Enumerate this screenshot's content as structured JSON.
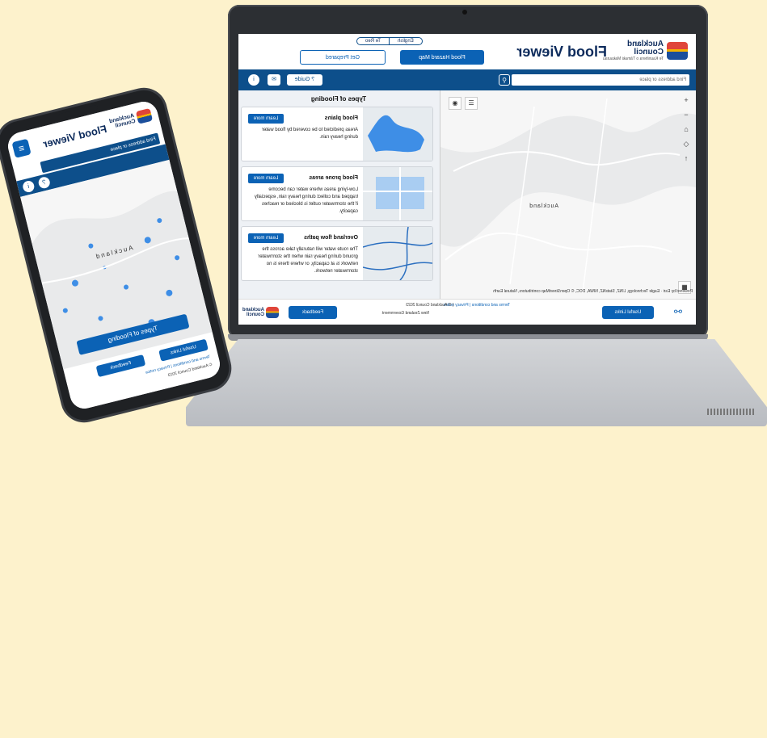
{
  "laptop": {
    "header": {
      "logo_name": "Auckland Council",
      "logo_sub": "Te Kaunihera o Tāmaki Makaurau",
      "title": "Flood Viewer",
      "lang_english": "English",
      "lang_tereo": "Te Reo",
      "hazard_button": "Flood Hazard Map",
      "prepared_button": "Get Prepared"
    },
    "toolbar": {
      "search_placeholder": "Find address or place",
      "guide_button": "Guide"
    },
    "map": {
      "place_label": "Auckland",
      "powered_by": "Powered by Esri",
      "attribution": "Eagle Technology, LINZ, StatsNZ, NIWA, DOC, © OpenStreetMap contributors, Natural Earth"
    },
    "panel": {
      "title": "Types of Flooding",
      "cards": [
        {
          "title": "Flood plains",
          "desc": "Areas predicted to be covered by flood water during heavy rain.",
          "button": "Learn more"
        },
        {
          "title": "Flood prone areas",
          "desc": "Low-lying areas where water can become trapped and collect during heavy rain, especially if the stormwater outlet is blocked or reaches capacity.",
          "button": "Learn more"
        },
        {
          "title": "Overland flow paths",
          "desc": "The route water will naturally take across the ground during heavy rain when the stormwater network is at capacity, or where there is no stormwater network.",
          "button": "Learn more"
        }
      ]
    },
    "footer": {
      "useful_links": "Useful Links",
      "terms": "Terms and conditions | Privacy notice",
      "copyright": "| © Auckland Council 2023",
      "nzgov": "New Zealand Government",
      "feedback": "Feedback"
    }
  },
  "phone": {
    "title": "Flood Viewer",
    "logo_name": "Auckland Council",
    "search_placeholder": "Find address or place",
    "map_label": "Auckland",
    "types_button": "Types of Flooding",
    "useful_links": "Useful Links",
    "feedback": "Feedback",
    "terms": "Terms and conditions | Privacy notice",
    "copyright": "© Auckland Council 2023"
  },
  "colors": {
    "background": "#fdf2cc",
    "brand_blue": "#0b62b5",
    "bar_blue": "#0d4f8b",
    "flood_blue": "#3e8ee6"
  }
}
